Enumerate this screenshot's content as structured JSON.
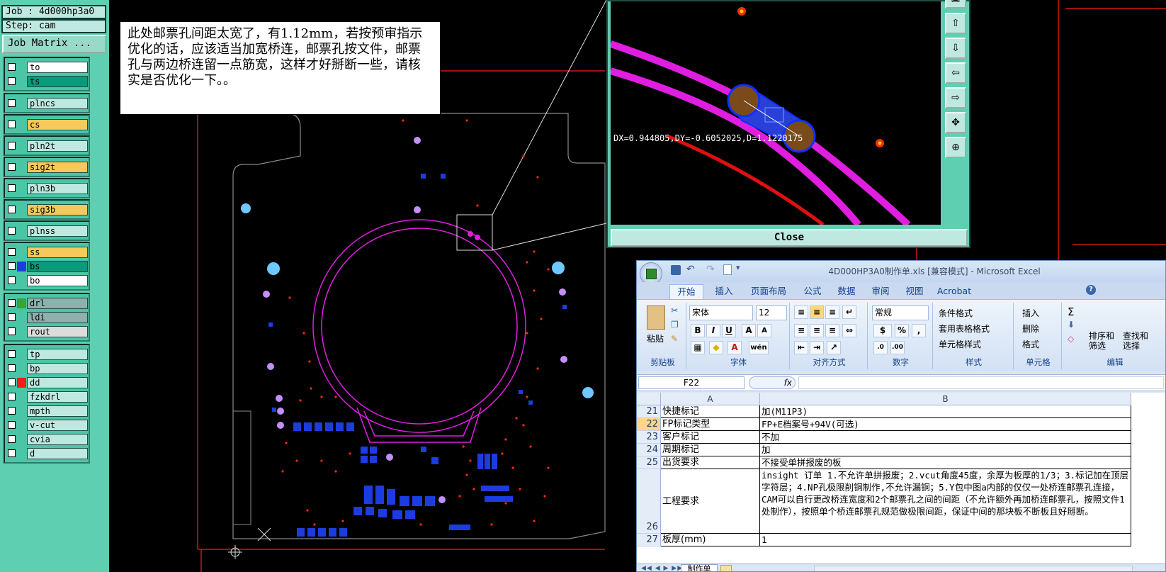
{
  "job_panel": {
    "job": "Job : 4d000hp3a0",
    "step": "Step: cam",
    "job_matrix": "Job Matrix ...",
    "groups": [
      [
        {
          "name": "to",
          "color": "#ffffff"
        },
        {
          "name": "ts",
          "color": "#0b9a7c"
        }
      ],
      [
        {
          "name": "plncs",
          "color": "#bfe9e0"
        }
      ],
      [
        {
          "name": "cs",
          "color": "#f7c95a"
        }
      ],
      [
        {
          "name": "pln2t",
          "color": "#bfe9e0"
        }
      ],
      [
        {
          "name": "sig2t",
          "color": "#f7c95a"
        }
      ],
      [
        {
          "name": "pln3b",
          "color": "#bfe9e0"
        }
      ],
      [
        {
          "name": "sig3b",
          "color": "#f7c95a"
        }
      ],
      [
        {
          "name": "plnss",
          "color": "#bfe9e0"
        }
      ],
      [
        {
          "name": "ss",
          "color": "#f7c95a"
        },
        {
          "name": "bs",
          "color": "#0b9a7c",
          "swatch": "#1d3ce0"
        },
        {
          "name": "bo",
          "color": "#ffffff"
        }
      ],
      [
        {
          "name": "drl",
          "color": "#8fb0ac",
          "swatch": "#3aa23a"
        },
        {
          "name": "ldi",
          "color": "#8fb0ac"
        },
        {
          "name": "rout",
          "color": "#dcdcdc"
        }
      ],
      [
        {
          "name": "tp",
          "color": "#bfe9e0"
        },
        {
          "name": "bp",
          "color": "#bfe9e0"
        },
        {
          "name": "dd",
          "color": "#bfe9e0",
          "swatch": "#ff1a1a"
        },
        {
          "name": "fzkdrl",
          "color": "#bfe9e0"
        },
        {
          "name": "mpth",
          "color": "#bfe9e0"
        },
        {
          "name": "v-cut",
          "color": "#bfe9e0"
        },
        {
          "name": "cvia",
          "color": "#bfe9e0"
        },
        {
          "name": "d",
          "color": "#bfe9e0"
        }
      ]
    ]
  },
  "note": {
    "text": "此处邮票孔间距太宽了，有1.12mm，若按预审指示优化的话，应该适当加宽桥连，邮票孔按文件，邮票孔与两边桥连留一点筋宽，这样才好掰断一些，请核实是否优化一下。。"
  },
  "zoom_window": {
    "measure": "DX=0.944805,DY=-0.6052025,D=1.1220175",
    "close_label": "Close"
  },
  "excel": {
    "title": "4D000HP3A0制作单.xls  [兼容模式] - Microsoft Excel",
    "tabs": [
      "开始",
      "插入",
      "页面布局",
      "公式",
      "数据",
      "审阅",
      "视图",
      "Acrobat"
    ],
    "ribbon": {
      "paste": "粘贴",
      "clipboard": "剪贴板",
      "font_name": "宋体",
      "font_size": "12",
      "font_group": "字体",
      "align_group": "对齐方式",
      "number_format": "常规",
      "number_group": "数字",
      "cond_format": "条件格式",
      "table_format": "套用表格格式",
      "cell_style": "单元格样式",
      "style_group": "样式",
      "insert": "插入",
      "delete": "删除",
      "format": "格式",
      "cells_group": "单元格",
      "sort_filter": "排序和\n筛选",
      "find_select": "查找和\n选择",
      "edit_group": "编辑"
    },
    "name_box": "F22",
    "fx": "fx",
    "columns": [
      "A",
      "B"
    ],
    "rows": [
      {
        "num": "21",
        "a": "快捷标记",
        "b": "加(M11P3)"
      },
      {
        "num": "22",
        "a": "FP标记类型",
        "b": "FP+E档案号+94V(可选)"
      },
      {
        "num": "23",
        "a": "客户标记",
        "b": "不加"
      },
      {
        "num": "24",
        "a": "周期标记",
        "b": "加"
      },
      {
        "num": "25",
        "a": "出货要求",
        "b": "不接受单拼报废的板"
      },
      {
        "num": "26",
        "a": "工程要求",
        "b": "insight 订单  1.不允许单拼报废；2.vcut角度45度，余厚为板厚的1/3；3.标记加在顶层字符层；4.NP孔极限削铜制作,不允许漏铜；5.Y包中图a内部的仅仅一处桥连邮票孔连接，CAM可以自行更改桥连宽度和2个邮票孔之间的间距（不允许额外再加桥连邮票孔，按照文件1处制作），按照单个桥连邮票孔规范做极限间距，保证中间的那块板不断板且好掰断。"
      },
      {
        "num": "27",
        "a": "板厚(mm)",
        "b": "1"
      }
    ],
    "sheet_tab": "制作单"
  }
}
